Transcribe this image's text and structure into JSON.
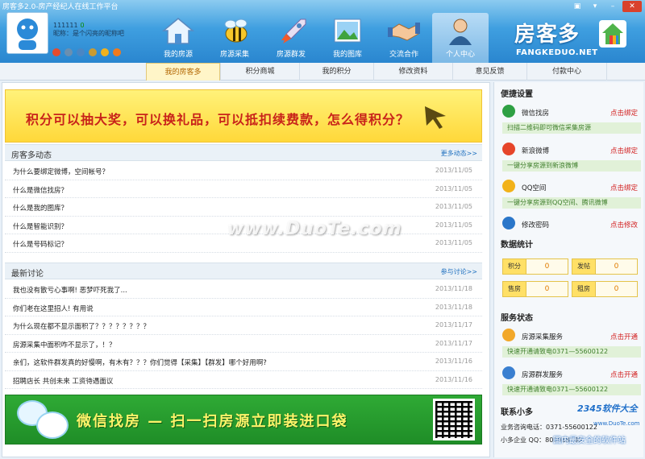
{
  "window": {
    "title": "房客多2.0-房产经纪人在线工作平台"
  },
  "user": {
    "id": "111111",
    "points": "0",
    "nickname": "昵称：是个闪亮的昵称吧"
  },
  "nav": [
    {
      "label": "我的房源",
      "icon": "house-icon"
    },
    {
      "label": "房源采集",
      "icon": "bee-icon"
    },
    {
      "label": "房源群发",
      "icon": "rocket-icon"
    },
    {
      "label": "我的图库",
      "icon": "picture-icon"
    },
    {
      "label": "交流合作",
      "icon": "handshake-icon"
    },
    {
      "label": "个人中心",
      "icon": "person-icon"
    }
  ],
  "logo": {
    "text": "房客多",
    "sub": "FANGKEDUO.NET"
  },
  "tabs": [
    "我的房客多",
    "积分商城",
    "我的积分",
    "修改资料",
    "意见反馈",
    "付款中心"
  ],
  "promo": {
    "text": "积分可以抽大奖，可以换礼品，可以抵扣续费款，怎么得积分？"
  },
  "news": {
    "title": "房客多动态",
    "more": "更多动态>>",
    "items": [
      {
        "title": "为什么要绑定微博，空间帐号？",
        "date": "2013/11/05"
      },
      {
        "title": "什么是微信找房？",
        "date": "2013/11/05"
      },
      {
        "title": "什么是我的图库？",
        "date": "2013/11/05"
      },
      {
        "title": "什么是智能识别？",
        "date": "2013/11/05"
      },
      {
        "title": "什么是号码标记？",
        "date": "2013/11/05"
      }
    ]
  },
  "discuss": {
    "title": "最新讨论",
    "more": "参与讨论>>",
    "items": [
      {
        "title": "我也没有散亏心事啊! 恶梦吓死我了...",
        "date": "2013/11/18"
      },
      {
        "title": "你们老在这里招人! 有用说",
        "date": "2013/11/18"
      },
      {
        "title": "为什么现在都不显示面积了？？？？？？？？",
        "date": "2013/11/17"
      },
      {
        "title": "房源采集中面积咋不显示了，！？",
        "date": "2013/11/17"
      },
      {
        "title": "亲们，这软件群发真的好慢啊，有木有？？？你们觉得【采集】【群发】哪个好用啊?",
        "date": "2013/11/16"
      },
      {
        "title": "招聘店长 共创未来 工资待遇面议",
        "date": "2013/11/16"
      }
    ]
  },
  "banner": {
    "text": "微信找房 — 扫一扫房源立即装进口袋"
  },
  "sidebar": {
    "quick_title": "便捷设置",
    "binds": [
      {
        "name": "微信找房",
        "action": "点击绑定",
        "desc": "扫描二维码即可微信采集房源",
        "icon": "wechat-icon",
        "color": "#2ea043"
      },
      {
        "name": "新浪微博",
        "action": "点击绑定",
        "desc": "一键分享房源到新浪微博",
        "icon": "weibo-icon",
        "color": "#e6452a"
      },
      {
        "name": "QQ空间",
        "action": "点击绑定",
        "desc": "一键分享房源到QQ空间、腾讯微博",
        "icon": "qzone-icon",
        "color": "#f2b21a"
      },
      {
        "name": "修改密码",
        "action": "点击修改",
        "desc": "",
        "icon": "globe-icon",
        "color": "#2a76c9"
      }
    ],
    "stats_title": "数据统计",
    "stats": [
      {
        "label": "积分",
        "value": "0"
      },
      {
        "label": "发帖",
        "value": "0"
      },
      {
        "label": "售房",
        "value": "0"
      },
      {
        "label": "租房",
        "value": "0"
      }
    ],
    "service_title": "服务状态",
    "services": [
      {
        "name": "房源采集服务",
        "action": "点击开通",
        "desc": "快速开通请致电0371—55600122",
        "icon": "collect-icon"
      },
      {
        "name": "房源群发服务",
        "action": "点击开通",
        "desc": "快速开通请致电0371—55600122",
        "icon": "broadcast-icon"
      }
    ],
    "contact_title": "联系小多",
    "contact_lines": [
      "业务咨询电话：0371-55600122",
      "小多企业 QQ：800018189"
    ]
  },
  "watermarks": {
    "center": "www.DuoTe.com",
    "corner": "2345软件大全",
    "corner_url": "www.DuoTe.com",
    "corner_sub": "国内最安全的软件站"
  }
}
